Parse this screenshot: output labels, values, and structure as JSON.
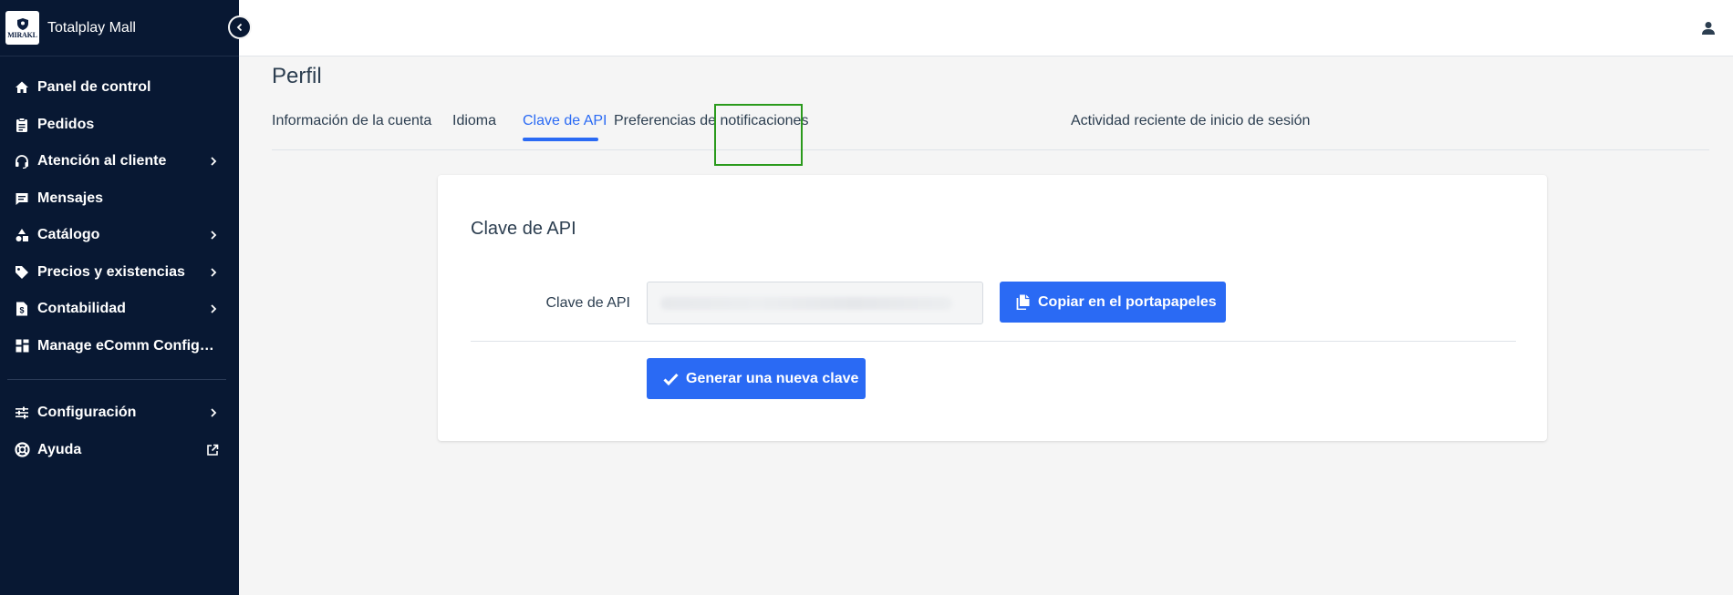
{
  "brand": {
    "name": "Totalplay Mall",
    "logo_text": "MIRAKL"
  },
  "sidebar": {
    "items": [
      {
        "label": "Panel de control",
        "icon": "home-icon",
        "has_chevron": false
      },
      {
        "label": "Pedidos",
        "icon": "clipboard-icon",
        "has_chevron": false
      },
      {
        "label": "Atención al cliente",
        "icon": "headset-icon",
        "has_chevron": true
      },
      {
        "label": "Mensajes",
        "icon": "message-icon",
        "has_chevron": false
      },
      {
        "label": "Catálogo",
        "icon": "shapes-icon",
        "has_chevron": true
      },
      {
        "label": "Precios y existencias",
        "icon": "tag-icon",
        "has_chevron": true
      },
      {
        "label": "Contabilidad",
        "icon": "invoice-icon",
        "has_chevron": true
      },
      {
        "label": "Manage eComm Configur...",
        "icon": "grid-icon",
        "has_chevron": false
      }
    ],
    "bottom_items": [
      {
        "label": "Configuración",
        "icon": "sliders-icon",
        "has_chevron": true
      },
      {
        "label": "Ayuda",
        "icon": "lifebuoy-icon",
        "has_chevron": false,
        "external": true
      }
    ]
  },
  "page": {
    "title": "Perfil",
    "tabs": [
      {
        "label": "Información de la cuenta",
        "active": false
      },
      {
        "label": "Idioma",
        "active": false
      },
      {
        "label": "Clave de API",
        "active": true
      },
      {
        "label": "Preferencias de notificaciones",
        "active": false
      },
      {
        "label": "Actividad reciente de inicio de sesión",
        "active": false
      }
    ]
  },
  "api_card": {
    "title": "Clave de API",
    "field_label": "Clave de API",
    "field_value": "",
    "copy_button": "Copiar en el portapapeles",
    "generate_button": "Generar una nueva clave"
  },
  "colors": {
    "sidebar_bg": "#081833",
    "accent": "#2a6af4",
    "highlight_border": "#2a9a1c",
    "page_bg": "#f5f5f5"
  }
}
